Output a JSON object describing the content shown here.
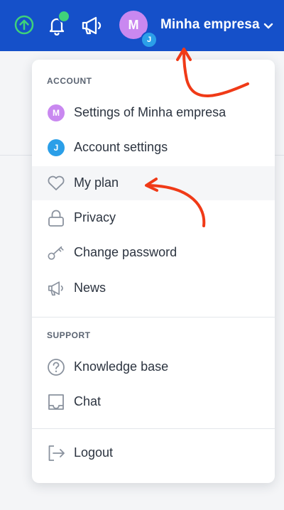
{
  "header": {
    "company_name": "Minha empresa",
    "avatar_initial": "M",
    "avatar_badge": "J",
    "icons": [
      "upload-circle-icon",
      "bell-icon",
      "megaphone-icon",
      "chevron-down-icon"
    ]
  },
  "menu": {
    "account_title": "ACCOUNT",
    "support_title": "SUPPORT",
    "account_items": [
      {
        "label": "Settings of Minha empresa",
        "icon": "company-avatar-icon",
        "badge": "M"
      },
      {
        "label": "Account settings",
        "icon": "user-avatar-icon",
        "badge": "J"
      },
      {
        "label": "My plan",
        "icon": "heart-icon"
      },
      {
        "label": "Privacy",
        "icon": "lock-icon"
      },
      {
        "label": "Change password",
        "icon": "key-icon"
      },
      {
        "label": "News",
        "icon": "megaphone-icon"
      }
    ],
    "support_items": [
      {
        "label": "Knowledge base",
        "icon": "help-circle-icon"
      },
      {
        "label": "Chat",
        "icon": "chat-icon"
      }
    ],
    "logout_label": "Logout"
  },
  "colors": {
    "topbar": "#1550c9",
    "accent_green": "#3fd27a",
    "avatar_purple": "#c988f0",
    "avatar_blue": "#2b9fe8",
    "annotation_arrow": "#f03a17"
  }
}
